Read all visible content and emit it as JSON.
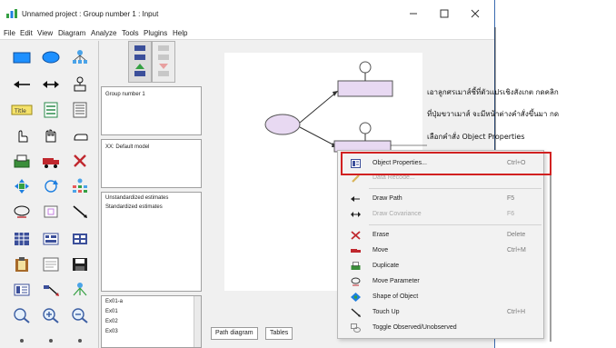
{
  "window": {
    "title": "Unnamed project : Group number 1 : Input",
    "controls": {
      "minimize": "−",
      "maximize": "☐",
      "close": "✕"
    }
  },
  "menubar": {
    "items": [
      "File",
      "Edit",
      "View",
      "Diagram",
      "Analyze",
      "Tools",
      "Plugins",
      "Help"
    ]
  },
  "panels": {
    "group": "Group number 1",
    "model": "XX: Default model",
    "estimates": [
      "Unstandardized estimates",
      "Standardized estimates"
    ],
    "variables": [
      "Ex01-a",
      "Ex01",
      "Ex02",
      "Ex03"
    ]
  },
  "tabs": [
    "Path diagram",
    "Tables"
  ],
  "status": {
    "text": ""
  },
  "annotation": {
    "lines": [
      "เอาลูกศรเมาส์ชี้ที่ตัวแปรเชิงสังเกต กดคลิก",
      "ที่ปุ่มขวาเมาส์ จะมีหน้าต่างคำสั่งขึ้นมา กด",
      "เลือกคำสั่ง Object Properties"
    ]
  },
  "context_menu": {
    "items": [
      {
        "label": "Object Properties...",
        "shortcut": "Ctrl+O",
        "icon": "object-properties-icon"
      },
      {
        "label": "Data Recode...",
        "shortcut": "",
        "icon": "data-recode-icon",
        "disabled": true
      },
      {
        "label": "Draw Path",
        "shortcut": "F5",
        "icon": "draw-path-icon"
      },
      {
        "label": "Draw Covariance",
        "shortcut": "F6",
        "icon": "draw-covariance-icon",
        "disabled": true
      },
      {
        "label": "Erase",
        "shortcut": "Delete",
        "icon": "erase-icon"
      },
      {
        "label": "Move",
        "shortcut": "Ctrl+M",
        "icon": "move-icon"
      },
      {
        "label": "Duplicate",
        "shortcut": "",
        "icon": "duplicate-icon"
      },
      {
        "label": "Move Parameter",
        "shortcut": "",
        "icon": "move-parameter-icon"
      },
      {
        "label": "Shape of Object",
        "shortcut": "",
        "icon": "shape-of-object-icon"
      },
      {
        "label": "Touch Up",
        "shortcut": "Ctrl+H",
        "icon": "touch-up-icon"
      },
      {
        "label": "Toggle Observed/Unobserved",
        "shortcut": "",
        "icon": "toggle-observed-icon"
      }
    ]
  },
  "colors": {
    "highlight_border": "#d12121",
    "observed_fill": "#e8d9f2",
    "tool_blue": "#1e7fe0",
    "tool_green": "#35a043",
    "tool_red": "#c0282e"
  }
}
